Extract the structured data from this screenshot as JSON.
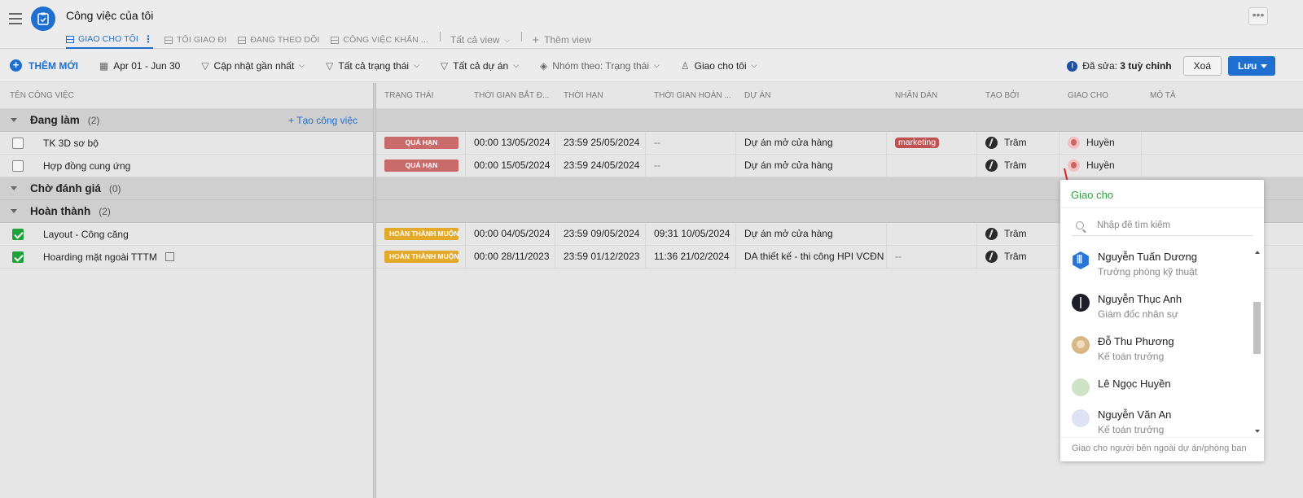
{
  "header": {
    "title": "Công việc của tôi",
    "tabs": [
      {
        "label": "GIAO CHO TÔI",
        "active": true
      },
      {
        "label": "TÔI GIAO ĐI",
        "active": false
      },
      {
        "label": "ĐANG THEO DÕI",
        "active": false
      },
      {
        "label": "CÔNG VIỆC KHẨN ...",
        "active": false
      }
    ],
    "all_views": "Tất cả view",
    "add_view": "Thêm view",
    "more": "•••"
  },
  "toolbar": {
    "add_new": "THÊM MỚI",
    "date_range": "Apr 01 - Jun 30",
    "sort": "Cập nhật gần nhất",
    "status_filter": "Tất cả trạng thái",
    "project_filter": "Tất cả dự án",
    "group_by": "Nhóm theo: Trạng thái",
    "assign_filter": "Giao cho tôi",
    "edited_prefix": "Đã sửa:",
    "edited_count": "3 tuỳ chỉnh",
    "clear": "Xoá",
    "save": "Lưu"
  },
  "left": {
    "column_header": "TÊN CÔNG VIỆC",
    "create_task": "+ Tạo công việc",
    "groups": [
      {
        "name": "Đang làm",
        "count": "(2)",
        "tasks": [
          {
            "name": "TK 3D sơ bộ",
            "done": false
          },
          {
            "name": "Hợp đồng cung ứng",
            "done": false
          }
        ]
      },
      {
        "name": "Chờ đánh giá",
        "count": "(0)",
        "tasks": []
      },
      {
        "name": "Hoàn thành",
        "count": "(2)",
        "tasks": [
          {
            "name": "Layout - Công căng",
            "done": true
          },
          {
            "name": "Hoarding mặt ngoài TTTM",
            "done": true
          }
        ]
      }
    ]
  },
  "grid": {
    "headers": [
      "TRẠNG THÁI",
      "THỜI GIAN BẮT Đ...",
      "THỜI HẠN",
      "THỜI GIAN HOÀN ...",
      "DỰ ÁN",
      "NHÃN DÁN",
      "TẠO BỞI",
      "GIAO CHO",
      "MÔ TẢ"
    ],
    "rows": [
      {
        "status": "QUÁ HẠN",
        "start": "00:00 13/05/2024",
        "deadline": "23:59 25/05/2024",
        "done_at": "--",
        "project": "Dự án mở cửa hàng",
        "tag": "marketing",
        "creator": "Trâm",
        "assignee": "Huyền"
      },
      {
        "status": "QUÁ HẠN",
        "start": "00:00 15/05/2024",
        "deadline": "23:59 24/05/2024",
        "done_at": "--",
        "project": "Dự án mở cửa hàng",
        "tag": "",
        "creator": "Trâm",
        "assignee": "Huyền"
      },
      {
        "status": "HOÀN THÀNH MUỘN",
        "start": "00:00 04/05/2024",
        "deadline": "23:59 09/05/2024",
        "done_at": "09:31 10/05/2024",
        "project": "Dự án mở cửa hàng",
        "tag": "",
        "creator": "Trâm",
        "assignee": ""
      },
      {
        "status": "HOÀN THÀNH MUỘN",
        "start": "00:00 28/11/2023",
        "deadline": "23:59 01/12/2023",
        "done_at": "11:36 21/02/2024",
        "project": "DA thiết kế - thi công HPI VCĐN",
        "tag": "--",
        "creator": "Trâm",
        "assignee": ""
      }
    ]
  },
  "popup": {
    "title": "Giao cho",
    "search_placeholder": "Nhập để tìm kiếm",
    "people": [
      {
        "name": "Nguyễn Tuấn Dương",
        "role": "Trưởng phòng kỹ thuật"
      },
      {
        "name": "Nguyễn Thục Anh",
        "role": "Giám đốc nhân sự"
      },
      {
        "name": "Đỗ Thu Phương",
        "role": "Kế toán trưởng"
      },
      {
        "name": "Lê Ngọc Huyền",
        "role": ""
      },
      {
        "name": "Nguyễn Văn An",
        "role": "Kế toán trưởng"
      }
    ],
    "footer": "Giao cho người bên ngoài dự án/phòng ban"
  },
  "colors": {
    "accent": "#1f6fd1",
    "overdue": "#c96b6b",
    "late": "#e2a92a",
    "done_check": "#1fa23a",
    "popup_title": "#2aa33a"
  }
}
